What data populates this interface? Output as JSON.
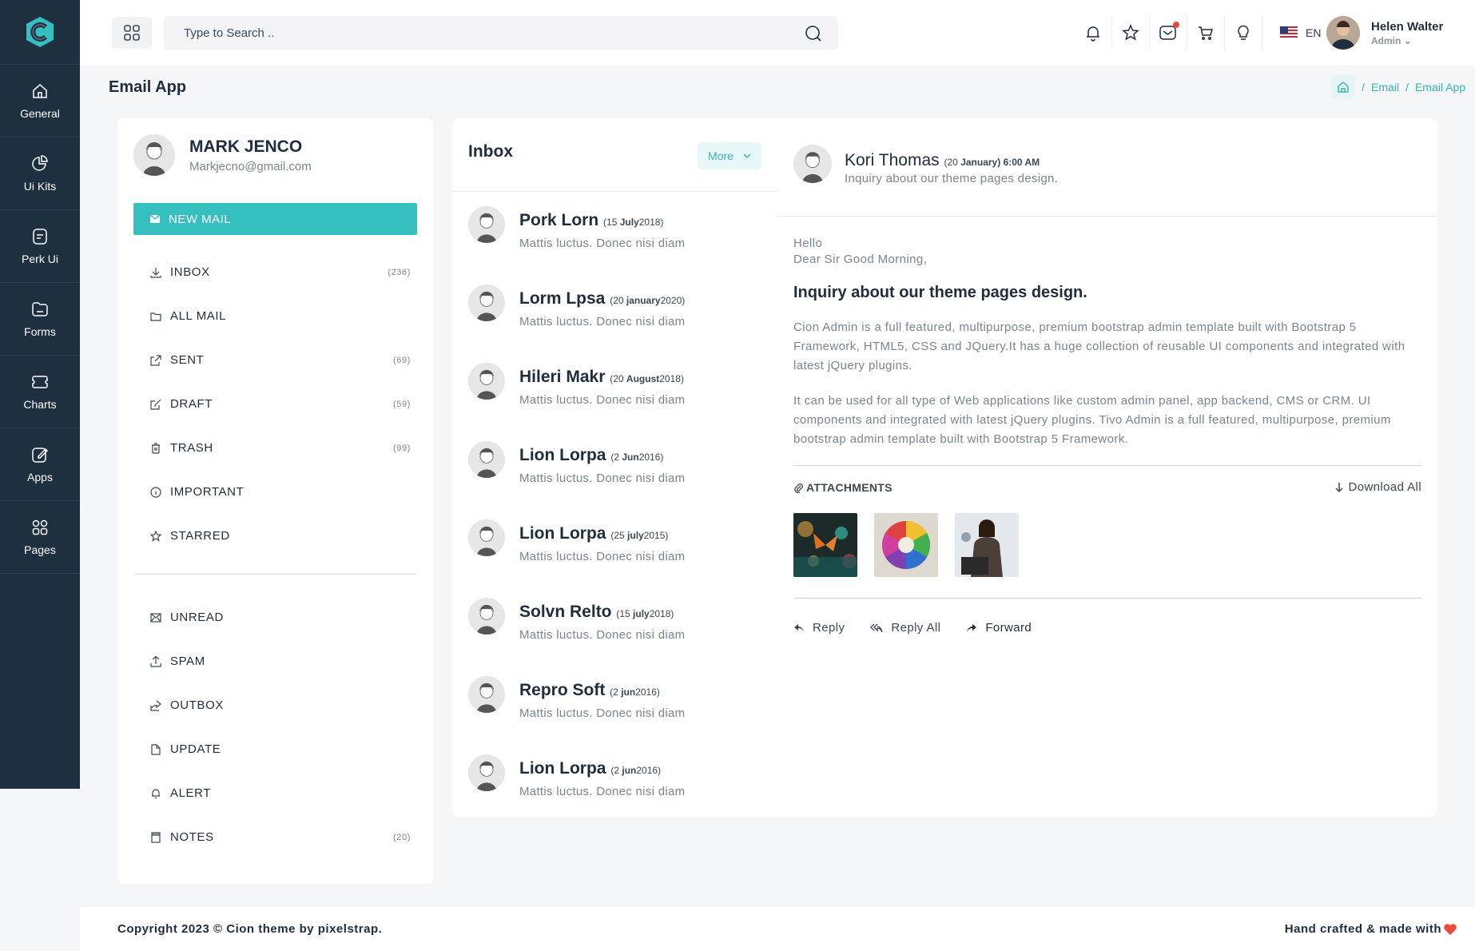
{
  "sidebar": {
    "items": [
      {
        "label": "General",
        "icon": "home-icon"
      },
      {
        "label": "Ui Kits",
        "icon": "pie-chart-icon"
      },
      {
        "label": "Perk Ui",
        "icon": "document-icon"
      },
      {
        "label": "Forms",
        "icon": "folder-icon"
      },
      {
        "label": "Charts",
        "icon": "ticket-icon"
      },
      {
        "label": "Apps",
        "icon": "edit-icon"
      },
      {
        "label": "Pages",
        "icon": "grid-icon"
      }
    ]
  },
  "header": {
    "search_placeholder": "Type to Search ..",
    "language": "EN",
    "user_name": "Helen Walter",
    "user_role": "Admin"
  },
  "page": {
    "title": "Email App",
    "breadcrumb": [
      "Email",
      "Email App"
    ]
  },
  "profile": {
    "name": "MARK JENCO",
    "email": "Markjecno@gmail.com",
    "new_mail_label": "NEW MAIL"
  },
  "folders_primary": [
    {
      "label": "INBOX",
      "count": "(236)",
      "icon": "download-icon"
    },
    {
      "label": "ALL MAIL",
      "count": "",
      "icon": "folder-icon"
    },
    {
      "label": "SENT",
      "count": "(69)",
      "icon": "external-link-icon"
    },
    {
      "label": "DRAFT",
      "count": "(59)",
      "icon": "edit-icon"
    },
    {
      "label": "TRASH",
      "count": "(99)",
      "icon": "trash-icon"
    },
    {
      "label": "IMPORTANT",
      "count": "",
      "icon": "info-icon"
    },
    {
      "label": "STARRED",
      "count": "",
      "icon": "star-icon"
    }
  ],
  "folders_secondary": [
    {
      "label": "UNREAD",
      "count": "",
      "icon": "mail-icon"
    },
    {
      "label": "SPAM",
      "count": "",
      "icon": "upload-icon"
    },
    {
      "label": "OUTBOX",
      "count": "",
      "icon": "share-icon"
    },
    {
      "label": "UPDATE",
      "count": "",
      "icon": "file-icon"
    },
    {
      "label": "ALERT",
      "count": "",
      "icon": "bell-icon"
    },
    {
      "label": "NOTES",
      "count": "(20)",
      "icon": "notes-icon"
    }
  ],
  "inbox": {
    "title": "Inbox",
    "more_label": "More",
    "items": [
      {
        "name": "Pork Lorn",
        "day": "(15 ",
        "month": "July",
        "year": "2018)",
        "snippet": "Mattis luctus. Donec nisi diam"
      },
      {
        "name": "Lorm Lpsa",
        "day": "(20 ",
        "month": "january",
        "year": "2020)",
        "snippet": "Mattis luctus. Donec nisi diam"
      },
      {
        "name": "Hileri Makr",
        "day": "(20 ",
        "month": "August",
        "year": "2018)",
        "snippet": "Mattis luctus. Donec nisi diam"
      },
      {
        "name": "Lion Lorpa",
        "day": "(2 ",
        "month": "Jun",
        "year": "2016)",
        "snippet": "Mattis luctus. Donec nisi diam"
      },
      {
        "name": "Lion Lorpa",
        "day": "(25 ",
        "month": "july",
        "year": "2015)",
        "snippet": "Mattis luctus. Donec nisi diam"
      },
      {
        "name": "Solvn Relto",
        "day": "(15 ",
        "month": "july",
        "year": "2018)",
        "snippet": "Mattis luctus. Donec nisi diam"
      },
      {
        "name": "Repro Soft",
        "day": "(2 ",
        "month": "jun",
        "year": "2016)",
        "snippet": "Mattis luctus. Donec nisi diam"
      },
      {
        "name": "Lion Lorpa",
        "day": "(2 ",
        "month": "jun",
        "year": "2016)",
        "snippet": "Mattis luctus. Donec nisi diam"
      }
    ]
  },
  "reader": {
    "sender": "Kori Thomas",
    "date_prefix": "(20 ",
    "date_bold": "January) ",
    "time": "6:00 AM",
    "subject_line": "Inquiry about our theme pages design.",
    "greeting1": "Hello",
    "greeting2": "Dear Sir Good Morning,",
    "title": "Inquiry about our theme pages design.",
    "para1": "Cion Admin is a full featured, multipurpose, premium bootstrap admin template built with Bootstrap 5 Framework, HTML5, CSS and JQuery.It has a huge collection of reusable UI components and integrated with latest jQuery plugins.",
    "para2": "It can be used for all type of Web applications like custom admin panel, app backend, CMS or CRM. UI components and integrated with latest jQuery plugins. Tivo Admin is a full featured, multipurpose, premium bootstrap admin template built with Bootstrap 5 Framework.",
    "attachments_label": "ATTACHMENTS",
    "download_all": "Download All",
    "reply": "Reply",
    "reply_all": "Reply All",
    "forward": "Forward"
  },
  "footer": {
    "copyright": "Copyright 2023 © Cion theme by pixelstrap.",
    "crafted": "Hand crafted & made with"
  },
  "colors": {
    "accent": "#36bfbf",
    "sidebar": "#1e2f3f",
    "heart": "#e74c3c"
  }
}
